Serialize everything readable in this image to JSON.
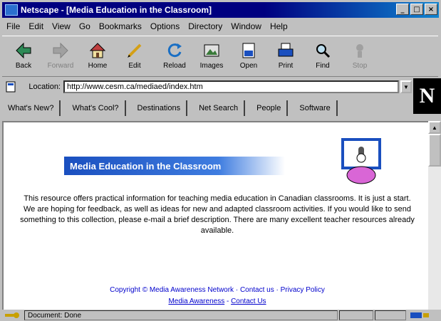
{
  "window": {
    "title": "Netscape - [Media Education in the Classroom]",
    "buttons": {
      "minimize": "_",
      "maximize": "□",
      "close": "×"
    }
  },
  "menu": [
    "File",
    "Edit",
    "View",
    "Go",
    "Bookmarks",
    "Options",
    "Directory",
    "Window",
    "Help"
  ],
  "toolbar": [
    {
      "label": "Back",
      "icon": "back-icon",
      "disabled": false
    },
    {
      "label": "Forward",
      "icon": "forward-icon",
      "disabled": true
    },
    {
      "label": "Home",
      "icon": "home-icon",
      "disabled": false
    },
    {
      "label": "Edit",
      "icon": "edit-icon",
      "disabled": false
    },
    {
      "label": "Reload",
      "icon": "reload-icon",
      "disabled": false
    },
    {
      "label": "Images",
      "icon": "images-icon",
      "disabled": false
    },
    {
      "label": "Open",
      "icon": "open-icon",
      "disabled": false
    },
    {
      "label": "Print",
      "icon": "print-icon",
      "disabled": false
    },
    {
      "label": "Find",
      "icon": "find-icon",
      "disabled": false
    },
    {
      "label": "Stop",
      "icon": "stop-icon",
      "disabled": true
    }
  ],
  "location": {
    "label": "Location:",
    "value": "http://www.cesm.ca/mediaed/index.htm"
  },
  "personal_toolbar": [
    "What's New?",
    "What's Cool?",
    "Destinations",
    "Net Search",
    "People",
    "Software"
  ],
  "throbber": {
    "letter": "N"
  },
  "content": {
    "banner_title": "Media Education in the Classroom",
    "paragraph": "This resource offers practical information for teaching media education in Canadian classrooms. It is just a start. We are hoping for feedback, as well as ideas for new and adapted classroom activities. If you would like to send something to this collection, please e-mail a brief description. There are many excellent teacher resources already available.",
    "link_line1": "Copyright © Media Awareness Network · Contact us · Privacy Policy",
    "link_line2a": "Media Awareness",
    "link_line2_sep": " - ",
    "link_line2b": "Contact Us"
  },
  "status": {
    "text": "Document: Done"
  },
  "colors": {
    "titlebar": "#000080",
    "link": "#0000cc",
    "banner": "#1a4fbf"
  }
}
